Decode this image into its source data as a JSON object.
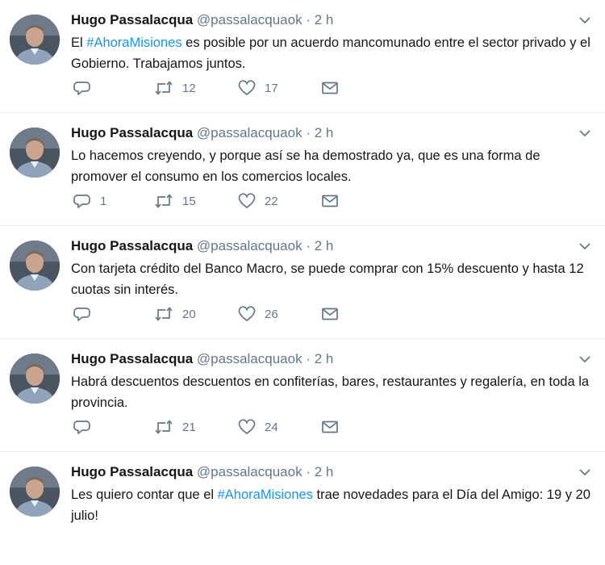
{
  "tweets": [
    {
      "author": "Hugo Passalacqua",
      "handle": "@passalacquaok",
      "separator": "·",
      "time": "2 h",
      "text_before": "El ",
      "hashtag": "#AhoraMisiones",
      "text_after": " es posible por un acuerdo mancomunado entre el sector privado y el Gobierno. Trabajamos juntos.",
      "replies": "",
      "retweets": "12",
      "likes": "17"
    },
    {
      "author": "Hugo Passalacqua",
      "handle": "@passalacquaok",
      "separator": "·",
      "time": "2 h",
      "text": "Lo hacemos creyendo, y porque así se ha demostrado ya,  que es una forma de promover el consumo en los comercios locales.",
      "replies": "1",
      "retweets": "15",
      "likes": "22"
    },
    {
      "author": "Hugo Passalacqua",
      "handle": "@passalacquaok",
      "separator": "·",
      "time": "2 h",
      "text": "Con tarjeta crédito del Banco Macro, se puede comprar con 15% descuento y hasta 12 cuotas sin interés.",
      "replies": "",
      "retweets": "20",
      "likes": "26"
    },
    {
      "author": "Hugo Passalacqua",
      "handle": "@passalacquaok",
      "separator": "·",
      "time": "2 h",
      "text": "Habrá descuentos descuentos en confiterías, bares, restaurantes y regalería,  en toda la provincia.",
      "replies": "",
      "retweets": "21",
      "likes": "24"
    },
    {
      "author": "Hugo Passalacqua",
      "handle": "@passalacquaok",
      "separator": "·",
      "time": "2 h",
      "text_before": "Les quiero contar que el ",
      "hashtag": "#AhoraMisiones",
      "text_after": " trae novedades para el Día del Amigo: 19 y 20 julio!"
    }
  ],
  "icons": {
    "reply": "reply-icon",
    "retweet": "retweet-icon",
    "like": "heart-icon",
    "message": "envelope-icon",
    "menu": "chevron-down-icon",
    "avatar": "avatar"
  },
  "colors": {
    "hashtag": "#1b95e0",
    "secondary_text": "#657786",
    "divider": "#e6ecf0"
  }
}
